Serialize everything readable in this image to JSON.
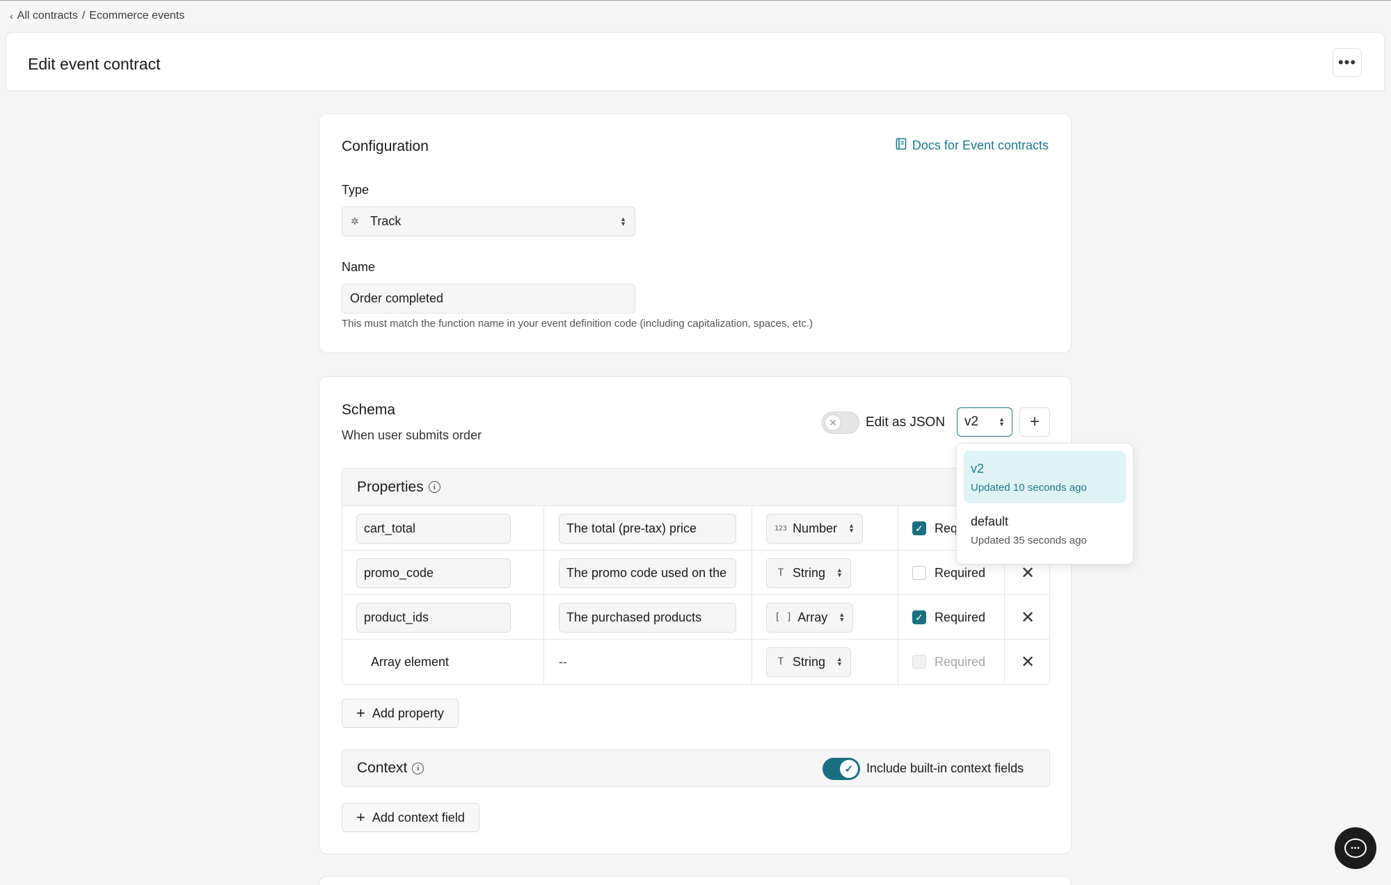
{
  "breadcrumb": {
    "parent": "All contracts",
    "separator": "/",
    "current": "Ecommerce events"
  },
  "header": {
    "title": "Edit event contract",
    "more_label": "•••"
  },
  "configuration": {
    "title": "Configuration",
    "docs_link": "Docs for Event contracts",
    "type_label": "Type",
    "type_value": "Track",
    "name_label": "Name",
    "name_value": "Order completed",
    "help_text": "This must match the function name in your event definition code (including capitalization, spaces, etc.)"
  },
  "schema": {
    "title": "Schema",
    "subtitle": "When user submits order",
    "edit_json_label": "Edit as JSON",
    "edit_json_on": false,
    "version_selected": "v2",
    "add_version_label": "+",
    "properties_title": "Properties",
    "rows": [
      {
        "name": "cart_total",
        "description": "The total (pre-tax) price",
        "type": "Number",
        "type_icon": "123",
        "required": true,
        "required_label": "Required"
      },
      {
        "name": "promo_code",
        "description": "The promo code used on the",
        "type": "String",
        "type_icon": "T",
        "required": false,
        "required_label": "Required"
      },
      {
        "name": "product_ids",
        "description": "The purchased products",
        "type": "Array",
        "type_icon": "[ ]",
        "required": true,
        "required_label": "Required"
      },
      {
        "name": "Array element",
        "description": "--",
        "type": "String",
        "type_icon": "T",
        "required": false,
        "required_label": "Required",
        "disabled": true
      }
    ],
    "add_property_label": "Add property",
    "context_title": "Context",
    "context_toggle_label": "Include built-in context fields",
    "context_toggle_on": true,
    "add_context_label": "Add context field"
  },
  "version_dropdown": {
    "options": [
      {
        "label": "v2",
        "updated": "Updated 10 seconds ago",
        "active": true
      },
      {
        "label": "default",
        "updated": "Updated 35 seconds ago",
        "active": false
      }
    ]
  },
  "colors": {
    "accent": "#1b7a8c",
    "toggle_on": "#1b6f82"
  }
}
